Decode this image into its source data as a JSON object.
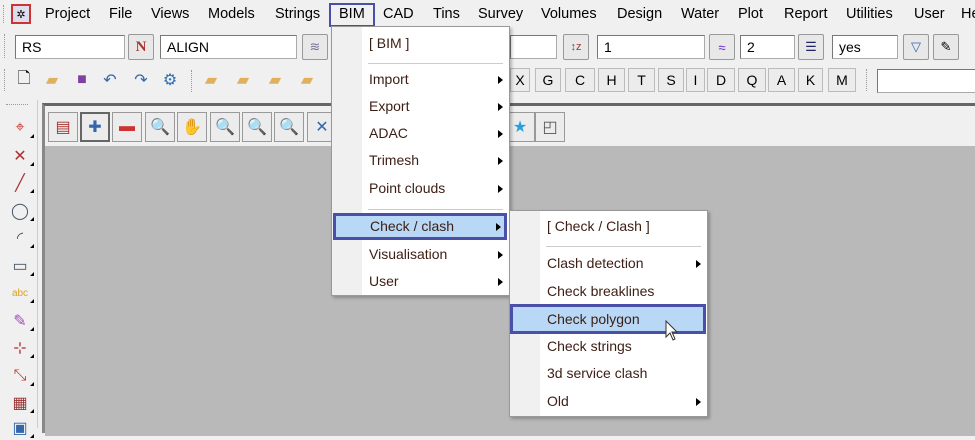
{
  "menubar": {
    "items": [
      "Project",
      "File",
      "Views",
      "Models",
      "Strings",
      "BIM",
      "CAD",
      "Tins",
      "Survey",
      "Volumes",
      "Design",
      "Water",
      "Plot",
      "Report",
      "Utilities",
      "User",
      "He"
    ],
    "active": "BIM"
  },
  "toolbar1": {
    "model_field": "RS",
    "name_button": "N",
    "string_field": "ALIGN",
    "field_1": "1",
    "field_2": "2",
    "field_yes": "yes"
  },
  "toolbar2": {
    "letters": [
      "X",
      "G",
      "C",
      "H",
      "T",
      "S",
      "I",
      "D",
      "Q",
      "A",
      "K",
      "M"
    ]
  },
  "bim_menu": {
    "items": [
      {
        "label": "[ BIM ]"
      },
      {
        "label": "Import",
        "submenu": true
      },
      {
        "label": "Export",
        "submenu": true
      },
      {
        "label": "ADAC",
        "submenu": true
      },
      {
        "label": "Trimesh",
        "submenu": true
      },
      {
        "label": "Point clouds",
        "submenu": true
      },
      {
        "label": "Check / clash",
        "submenu": true,
        "highlighted": true
      },
      {
        "label": "Visualisation",
        "submenu": true
      },
      {
        "label": "User",
        "submenu": true
      }
    ]
  },
  "check_menu": {
    "items": [
      {
        "label": "[ Check / Clash ]"
      },
      {
        "label": "Clash detection",
        "submenu": true
      },
      {
        "label": "Check breaklines"
      },
      {
        "label": "Check polygon",
        "highlighted": true
      },
      {
        "label": "Check strings"
      },
      {
        "label": "3d service clash"
      },
      {
        "label": "Old",
        "submenu": true
      }
    ]
  },
  "colors": {
    "highlight": "#b8d8f5",
    "highlight_border": "#4a4fa8",
    "view_bg": "#b9b9b9"
  }
}
